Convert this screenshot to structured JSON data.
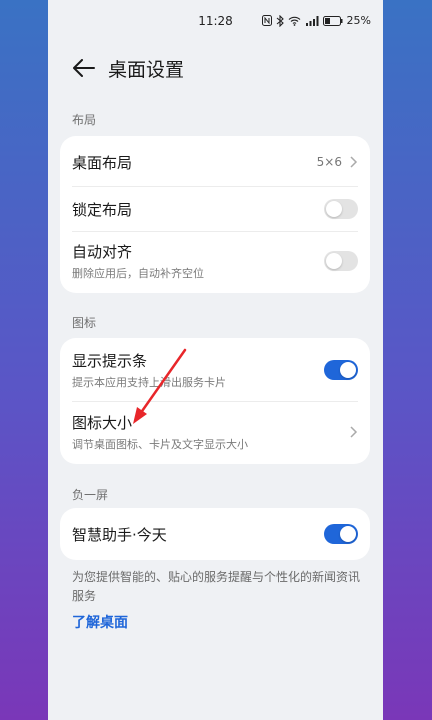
{
  "status": {
    "time": "11:28",
    "battery": "25%"
  },
  "header": {
    "title": "桌面设置"
  },
  "sections": {
    "layout": {
      "label": "布局",
      "items": [
        {
          "title": "桌面布局",
          "value": "5×6"
        },
        {
          "title": "锁定布局",
          "toggle": false
        },
        {
          "title": "自动对齐",
          "subtitle": "删除应用后，自动补齐空位",
          "toggle": false
        }
      ]
    },
    "icons": {
      "label": "图标",
      "items": [
        {
          "title": "显示提示条",
          "subtitle": "提示本应用支持上滑出服务卡片",
          "toggle": true
        },
        {
          "title": "图标大小",
          "subtitle": "调节桌面图标、卡片及文字显示大小"
        }
      ]
    },
    "minus_one": {
      "label": "负一屏",
      "items": [
        {
          "title": "智慧助手·今天",
          "toggle": true
        }
      ]
    }
  },
  "footer": {
    "description": "为您提供智能的、贴心的服务提醒与个性化的新闻资讯服务",
    "link": "了解桌面"
  },
  "colors": {
    "accent": "#1f66d9",
    "annotation_arrow": "#e8262a"
  }
}
